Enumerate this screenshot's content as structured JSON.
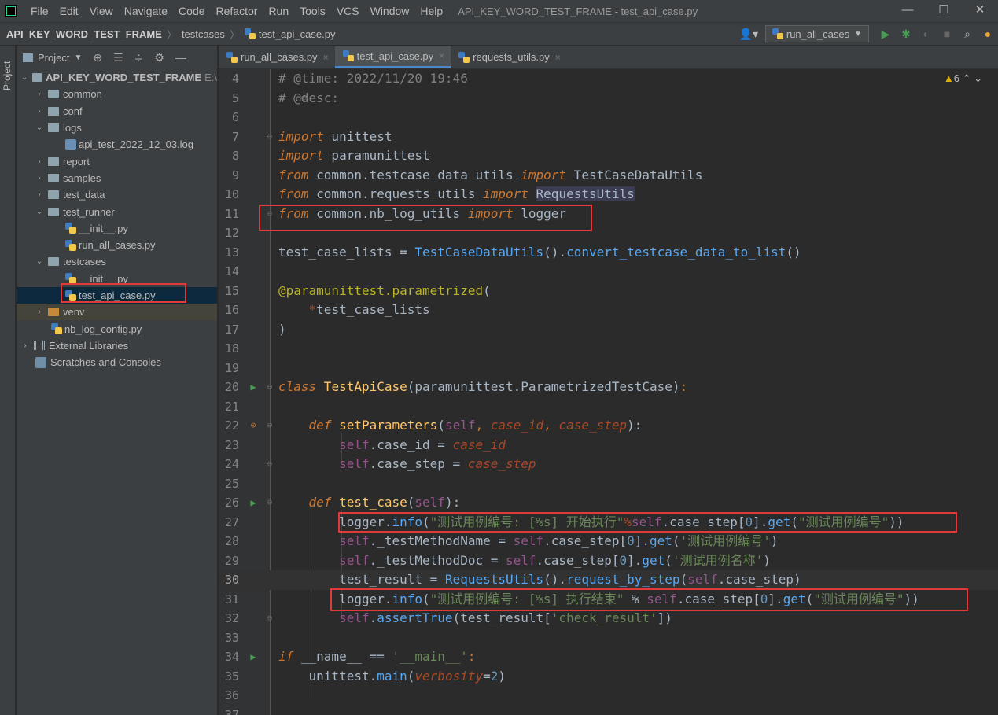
{
  "menubar": {
    "items": [
      "File",
      "Edit",
      "View",
      "Navigate",
      "Code",
      "Refactor",
      "Run",
      "Tools",
      "VCS",
      "Window",
      "Help"
    ],
    "title": "API_KEY_WORD_TEST_FRAME - test_api_case.py",
    "controls": [
      "—",
      "☐",
      "✕"
    ]
  },
  "navbar": {
    "project": "API_KEY_WORD_TEST_FRAME",
    "folder": "testcases",
    "file": "test_api_case.py",
    "run_config": "run_all_cases"
  },
  "sidebar_strip": {
    "label": "Project"
  },
  "project_panel": {
    "title": "Project",
    "root": "API_KEY_WORD_TEST_FRAME",
    "root_path": "E:\\",
    "items": [
      {
        "label": "common",
        "type": "folder",
        "level": 1,
        "open": false
      },
      {
        "label": "conf",
        "type": "folder",
        "level": 1,
        "open": false
      },
      {
        "label": "logs",
        "type": "folder",
        "level": 1,
        "open": true
      },
      {
        "label": "api_test_2022_12_03.log",
        "type": "log",
        "level": 2
      },
      {
        "label": "report",
        "type": "folder",
        "level": 1,
        "open": false
      },
      {
        "label": "samples",
        "type": "folder",
        "level": 1,
        "open": false
      },
      {
        "label": "test_data",
        "type": "folder",
        "level": 1,
        "open": false
      },
      {
        "label": "test_runner",
        "type": "folder",
        "level": 1,
        "open": true
      },
      {
        "label": "__init__.py",
        "type": "py",
        "level": 2
      },
      {
        "label": "run_all_cases.py",
        "type": "py",
        "level": 2
      },
      {
        "label": "testcases",
        "type": "folder",
        "level": 1,
        "open": true
      },
      {
        "label": "__init__.py",
        "type": "py",
        "level": 2
      },
      {
        "label": "test_api_case.py",
        "type": "py",
        "level": 2,
        "selected": true
      },
      {
        "label": "venv",
        "type": "venv",
        "level": 1,
        "open": false
      },
      {
        "label": "nb_log_config.py",
        "type": "py",
        "level": 1
      },
      {
        "label": "External Libraries",
        "type": "lib",
        "level": 0
      },
      {
        "label": "Scratches and Consoles",
        "type": "scratch",
        "level": 0
      }
    ]
  },
  "tabs": [
    {
      "label": "run_all_cases.py",
      "active": false
    },
    {
      "label": "test_api_case.py",
      "active": true
    },
    {
      "label": "requests_utils.py",
      "active": false
    }
  ],
  "editor": {
    "warning_count": "6",
    "line_numbers": [
      "4",
      "5",
      "6",
      "7",
      "8",
      "9",
      "10",
      "11",
      "12",
      "13",
      "14",
      "15",
      "16",
      "17",
      "18",
      "19",
      "20",
      "21",
      "22",
      "23",
      "24",
      "25",
      "26",
      "27",
      "28",
      "29",
      "30",
      "31",
      "32",
      "33",
      "34",
      "35",
      "36",
      "37"
    ],
    "current_line": "30",
    "code": {
      "l4a": "# @time: 2022/11/20 19:46",
      "l5a": "# @desc:",
      "l7a": "import",
      "l7b": " unittest",
      "l8a": "import",
      "l8b": " paramunittest",
      "l9a": "from",
      "l9b": " common.testcase_data_utils ",
      "l9c": "import",
      "l9d": " TestCaseDataUtils",
      "l10a": "from",
      "l10b": " common.requests_utils ",
      "l10c": "import",
      "l10d": "RequestsUtils",
      "l11a": "from",
      "l11b": " common.nb_log_utils ",
      "l11c": "import",
      "l11d": " logger",
      "l13a": "test_case_lists = ",
      "l13b": "TestCaseDataUtils",
      "l13c": "().",
      "l13d": "convert_testcase_data_to_list",
      "l13e": "()",
      "l15a": "@paramunittest.parametrized",
      "l15b": "(",
      "l16a": "*",
      "l16b": "test_case_lists",
      "l17a": ")",
      "l20a": "class",
      "l20b": " TestApiCase",
      "l20c": "(paramunittest.ParametrizedTestCase)",
      "l20d": ":",
      "l22a": "def",
      "l22b": " setParameters",
      "l22c": "(",
      "l22d": "self",
      "l22e": ", ",
      "l22f": "case_id",
      "l22g": ", ",
      "l22h": "case_step",
      "l22i": "):",
      "l23a": "self",
      "l23b": ".case_id = ",
      "l23c": "case_id",
      "l24a": "self",
      "l24b": ".case_step = ",
      "l24c": "case_step",
      "l26a": "def",
      "l26b": " test_case",
      "l26c": "(",
      "l26d": "self",
      "l26e": "):",
      "l27a": "logger.",
      "l27b": "info",
      "l27c": "(",
      "l27d": "\"测试用例编号: [%s] 开始执行\"",
      "l27e": "%",
      "l27f": "self",
      "l27g": ".case_step[",
      "l27h": "0",
      "l27i": "].",
      "l27j": "get",
      "l27k": "(",
      "l27l": "\"测试用例编号\"",
      "l27m": "))",
      "l28a": "self",
      "l28b": "._testMethodName = ",
      "l28c": "self",
      "l28d": ".case_step[",
      "l28e": "0",
      "l28f": "].",
      "l28g": "get",
      "l28h": "(",
      "l28i": "'测试用例编号'",
      "l28j": ")",
      "l29a": "self",
      "l29b": "._testMethodDoc = ",
      "l29c": "self",
      "l29d": ".case_step[",
      "l29e": "0",
      "l29f": "].",
      "l29g": "get",
      "l29h": "(",
      "l29i": "'测试用例名称'",
      "l29j": ")",
      "l30a": "test_result = ",
      "l30b": "RequestsUtils",
      "l30c": "().",
      "l30d": "request_by_step",
      "l30e": "(",
      "l30f": "self",
      "l30g": ".case_step)",
      "l31a": "logger.",
      "l31b": "info",
      "l31c": "(",
      "l31d": "\"测试用例编号: [%s] 执行结束\"",
      "l31e": " % ",
      "l31f": "self",
      "l31g": ".case_step[",
      "l31h": "0",
      "l31i": "].",
      "l31j": "get",
      "l31k": "(",
      "l31l": "\"测试用例编号\"",
      "l31m": "))",
      "l32a": "self",
      "l32b": ".",
      "l32c": "assertTrue",
      "l32d": "(test_result[",
      "l32e": "'check_result'",
      "l32f": "])",
      "l34a": "if",
      "l34b": " __name__ == ",
      "l34c": "'__main__'",
      "l34d": ":",
      "l35a": "unittest.",
      "l35b": "main",
      "l35c": "(",
      "l35d": "verbosity",
      "l35e": "=",
      "l35f": "2",
      "l35g": ")"
    }
  },
  "colors": {
    "accent": "#4a88c7",
    "highlight_box": "#e03a3a",
    "run_gutter": "#499c54",
    "keyword": "#cc7832",
    "string": "#6a8759"
  }
}
